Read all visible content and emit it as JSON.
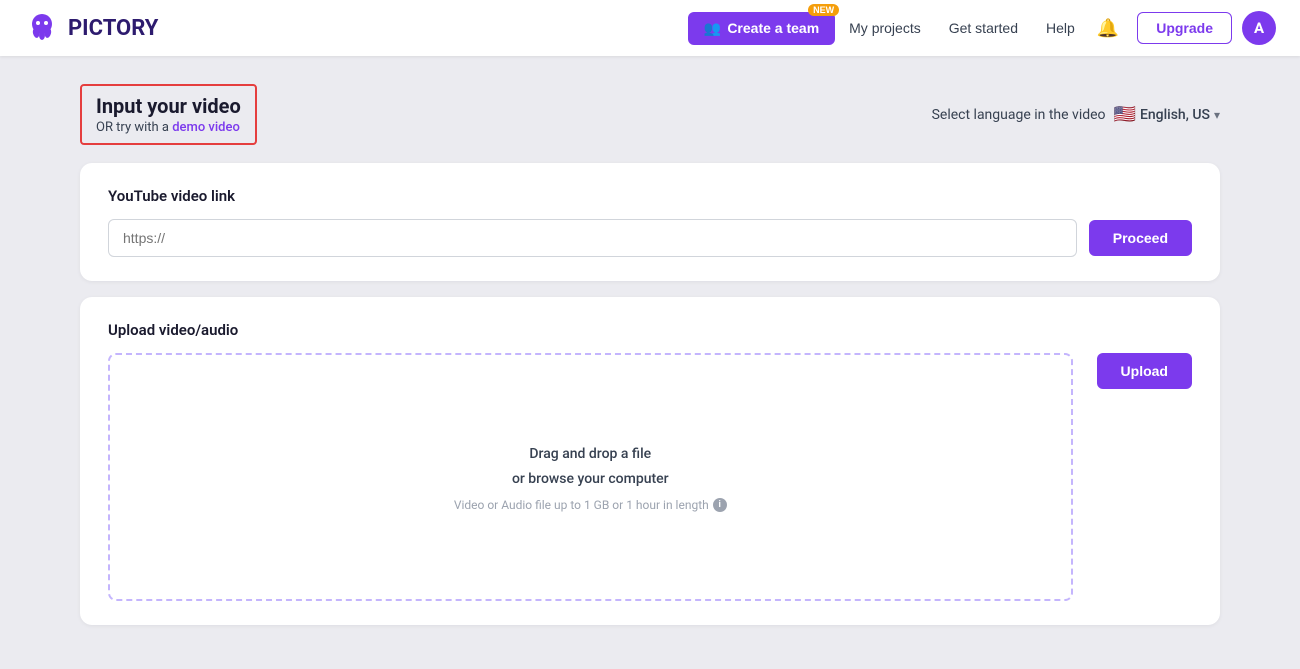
{
  "brand": {
    "name": "PICTORY",
    "logo_color": "#7c3aed"
  },
  "navbar": {
    "create_team_label": "Create a team",
    "new_badge": "NEW",
    "my_projects_label": "My projects",
    "get_started_label": "Get started",
    "help_label": "Help",
    "upgrade_label": "Upgrade",
    "avatar_letter": "A"
  },
  "header": {
    "input_video_title": "Input your video",
    "or_try_text": "OR try with a",
    "demo_link_text": "demo video",
    "select_language_label": "Select language in the video",
    "language_value": "English, US"
  },
  "youtube_card": {
    "label": "YouTube video link",
    "input_placeholder": "https://",
    "proceed_label": "Proceed"
  },
  "upload_card": {
    "label": "Upload video/audio",
    "dropzone_line1": "Drag and drop a file",
    "dropzone_line2": "or browse your computer",
    "dropzone_sub": "Video or Audio file up to 1 GB or 1 hour in length",
    "upload_label": "Upload"
  }
}
